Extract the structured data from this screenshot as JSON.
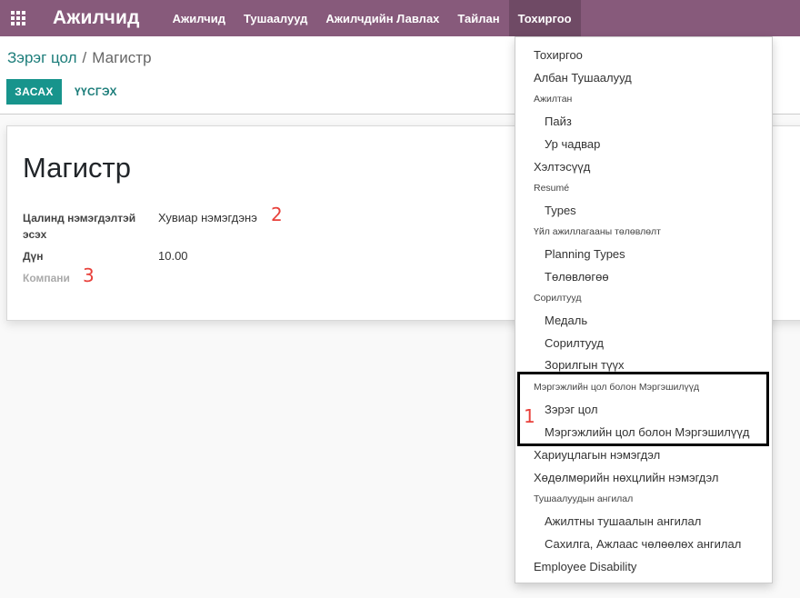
{
  "navbar": {
    "brand": "Ажилчид",
    "items": [
      {
        "label": "Ажилчид"
      },
      {
        "label": "Тушаалууд"
      },
      {
        "label": "Ажилчдийн Лавлах"
      },
      {
        "label": "Тайлан"
      },
      {
        "label": "Тохиргоо"
      }
    ]
  },
  "breadcrumb": {
    "parent": "Зэрэг цол",
    "separator": "/",
    "current": "Магистр"
  },
  "buttons": {
    "edit": "ЗАСАХ",
    "delete": "ҮҮСГЭХ"
  },
  "record": {
    "title": "Магистр",
    "fields": [
      {
        "label": "Цалинд нэмэгдэлтэй эсэх",
        "value": "Хувиар нэмэгдэнэ"
      },
      {
        "label": "Дүн",
        "value": "10.00"
      },
      {
        "label": "Компани",
        "value": ""
      }
    ]
  },
  "annotations": {
    "one": "1",
    "two": "2",
    "three": "3"
  },
  "dropdown": {
    "items": [
      {
        "text": "Тохиргоо"
      },
      {
        "text": "Албан Тушаалууд"
      },
      {
        "text": "Ажилтан"
      },
      {
        "text": "Пайз"
      },
      {
        "text": "Ур чадвар"
      },
      {
        "text": "Хэлтэсүүд"
      },
      {
        "text": "Resumé"
      },
      {
        "text": "Types"
      },
      {
        "text": "Үйл ажиллагааны төлөвлөлт"
      },
      {
        "text": "Planning Types"
      },
      {
        "text": "Төлөвлөгөө"
      },
      {
        "text": "Сорилтууд"
      },
      {
        "text": "Медаль"
      },
      {
        "text": "Сорилтууд"
      },
      {
        "text": "Зорилгын түүх"
      },
      {
        "text": "Мэргэжлийн цол болон Мэргэшилүүд"
      },
      {
        "text": "Зэрэг цол"
      },
      {
        "text": "Мэргэжлийн цол болон Мэргэшилүүд"
      },
      {
        "text": "Хариуцлагын нэмэгдэл"
      },
      {
        "text": "Хөдөлмөрийн нөхцлийн нэмэгдэл"
      },
      {
        "text": "Тушаалуудын ангилал"
      },
      {
        "text": "Ажилтны тушаалын ангилал"
      },
      {
        "text": "Сахилга, Ажлаас чөлөөлөх ангилал"
      },
      {
        "text": "Employee Disability"
      }
    ]
  },
  "colors": {
    "navbar": "#875a7b",
    "accent": "#17948c",
    "annotation": "#e8403a"
  }
}
